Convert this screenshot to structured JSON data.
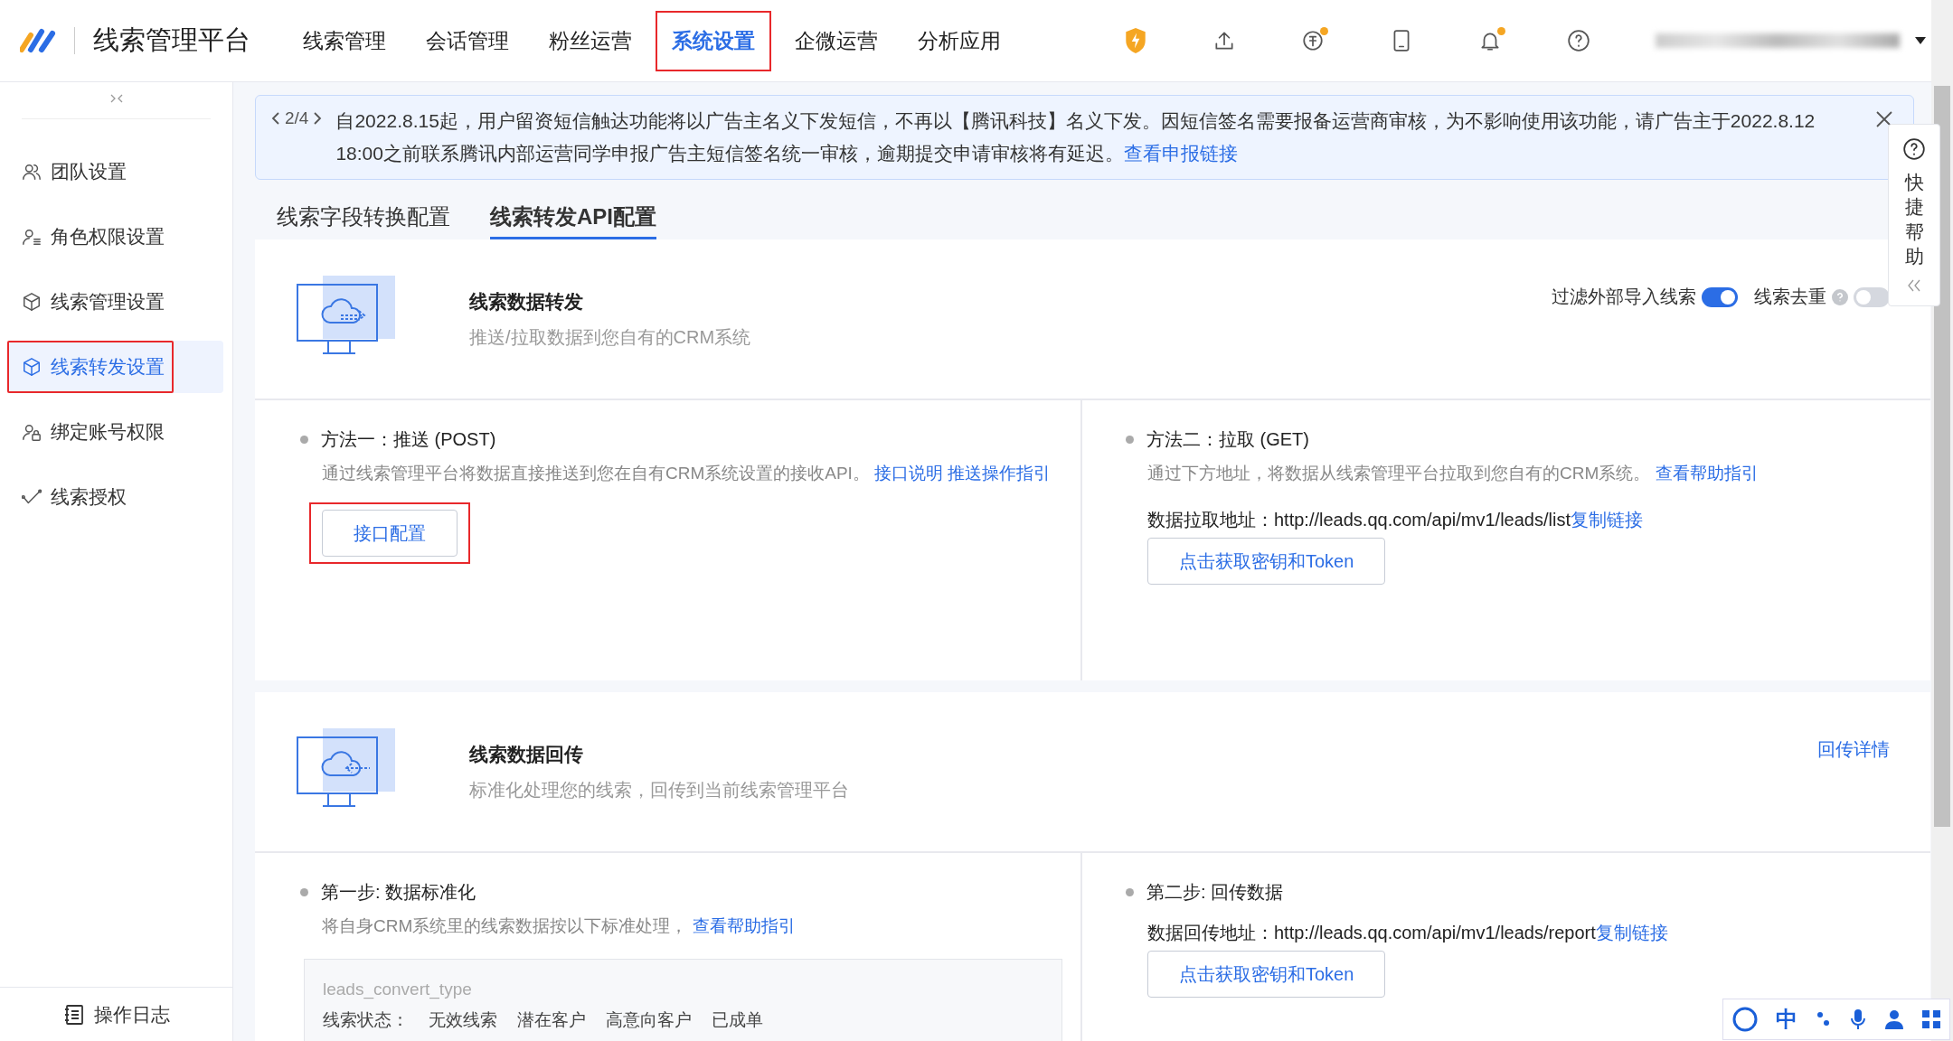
{
  "header": {
    "title": "线索管理平台",
    "nav": [
      {
        "label": "线索管理",
        "selected": false,
        "highlighted": false
      },
      {
        "label": "会话管理",
        "selected": false,
        "highlighted": false
      },
      {
        "label": "粉丝运营",
        "selected": false,
        "highlighted": false
      },
      {
        "label": "系统设置",
        "selected": true,
        "highlighted": true
      },
      {
        "label": "企微运营",
        "selected": false,
        "highlighted": false
      },
      {
        "label": "分析应用",
        "selected": false,
        "highlighted": false
      }
    ],
    "tools": [
      {
        "kind": "shield",
        "badge": false
      },
      {
        "kind": "upload",
        "badge": false
      },
      {
        "kind": "coin",
        "badge": true
      },
      {
        "kind": "tablet",
        "badge": false
      },
      {
        "kind": "bell",
        "badge": true
      },
      {
        "kind": "help",
        "badge": false
      }
    ]
  },
  "sidebar": {
    "items": [
      {
        "label": "团队设置",
        "kind": "team",
        "selected": false,
        "highlighted": false
      },
      {
        "label": "角色权限设置",
        "kind": "role",
        "selected": false,
        "highlighted": false
      },
      {
        "label": "线索管理设置",
        "kind": "cube",
        "selected": false,
        "highlighted": false
      },
      {
        "label": "线索转发设置",
        "kind": "cube",
        "selected": true,
        "highlighted": true
      },
      {
        "label": "绑定账号权限",
        "kind": "lock",
        "selected": false,
        "highlighted": false
      },
      {
        "label": "线索授权",
        "kind": "share",
        "selected": false,
        "highlighted": false
      }
    ],
    "footer": "操作日志"
  },
  "notice": {
    "pager": "2/4",
    "text": "自2022.8.15起，用户留资短信触达功能将以广告主名义下发短信，不再以【腾讯科技】名义下发。因短信签名需要报备运营商审核，为不影响使用该功能，请广告主于2022.8.12 18:00之前联系腾讯内部运营同学申报广告主短信签名统一审核，逾期提交申请审核将有延迟。",
    "link": "查看申报链接"
  },
  "tabs": [
    {
      "label": "线索字段转换配置",
      "selected": false
    },
    {
      "label": "线索转发API配置",
      "selected": true
    }
  ],
  "sections": [
    {
      "kind": "push",
      "title": "线索数据转发",
      "subtitle": "推送/拉取数据到您自有的CRM系统",
      "toggles": [
        {
          "label": "过滤外部导入线索",
          "on": true,
          "help": false
        },
        {
          "label": "线索去重",
          "on": false,
          "help": true
        }
      ],
      "columns": [
        {
          "title": "方法一：推送 (POST)",
          "desc": "通过线索管理平台将数据直接推送到您在自有CRM系统设置的接收API。",
          "links": [
            "接口说明",
            "推送操作指引"
          ],
          "button": "接口配置",
          "button_highlighted": true
        },
        {
          "title": "方法二：拉取 (GET)",
          "desc": "通过下方地址，将数据从线索管理平台拉取到您自有的CRM系统。",
          "links": [
            "查看帮助指引"
          ],
          "address_label": "数据拉取地址：",
          "address": "http://leads.qq.com/api/mv1/leads/list",
          "copy": "复制链接",
          "button": "点击获取密钥和Token",
          "button_highlighted": false
        }
      ]
    },
    {
      "kind": "return",
      "title": "线索数据回传",
      "subtitle": "标准化处理您的线索，回传到当前线索管理平台",
      "link": "回传详情",
      "columns": [
        {
          "title": "第一步: 数据标准化",
          "desc": "将自身CRM系统里的线索数据按以下标准处理，",
          "links": [
            "查看帮助指引"
          ],
          "code": {
            "key": "leads_convert_type",
            "label": "线索状态：",
            "values": [
              "无效线索",
              "潜在客户",
              "高意向客户",
              "已成单"
            ]
          }
        },
        {
          "title": "第二步: 回传数据",
          "address_label": "数据回传地址：",
          "address": "http://leads.qq.com/api/mv1/leads/report",
          "copy": "复制链接",
          "button": "点击获取密钥和Token",
          "button_highlighted": false
        }
      ]
    }
  ],
  "help_panel": {
    "label": "快捷帮助"
  },
  "ime_bar": {
    "label": "中"
  }
}
